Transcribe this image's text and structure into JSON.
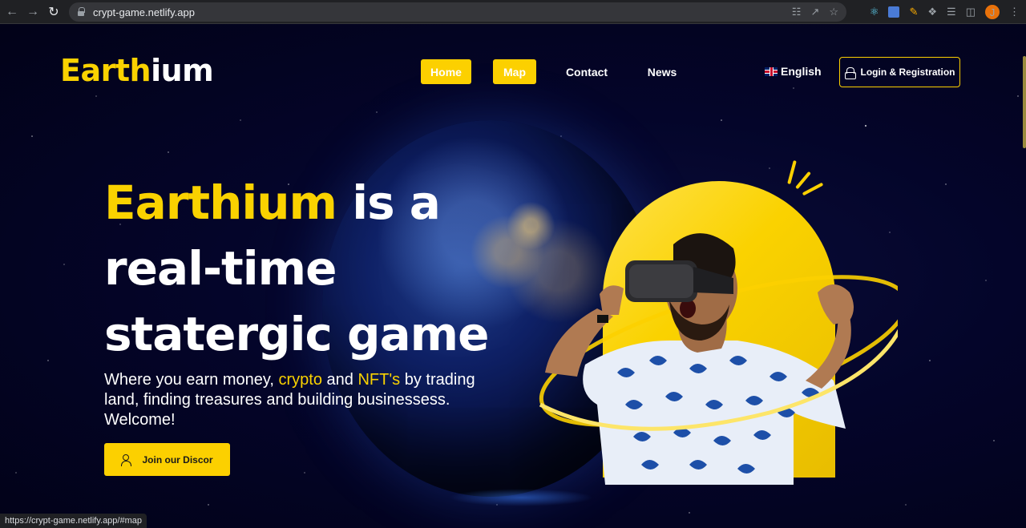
{
  "browser": {
    "url": "crypt-game.netlify.app",
    "profile_initial": "J",
    "status_url": "https://crypt-game.netlify.app/#map"
  },
  "header": {
    "logo_part1": "Earth",
    "logo_part2": "ium",
    "nav": [
      {
        "label": "Home",
        "active": true
      },
      {
        "label": "Map",
        "active": true
      },
      {
        "label": "Contact",
        "active": false
      },
      {
        "label": "News",
        "active": false
      }
    ],
    "language": "English",
    "login_label": "Login & Registration"
  },
  "hero": {
    "title_accent": "Earthium",
    "title_line1_rest": " is a",
    "title_line2": "real-time",
    "title_line3": "statergic game",
    "sub_part1": "Where you earn money, ",
    "sub_accent1": "crypto",
    "sub_part2": " and ",
    "sub_accent2": "NFT's",
    "sub_part3": " by trading land, finding treasures and building businessess. Welcome!",
    "cta_label": "Join our Discor"
  },
  "colors": {
    "accent": "#fcd000",
    "background": "#03031f",
    "text": "#ffffff"
  }
}
